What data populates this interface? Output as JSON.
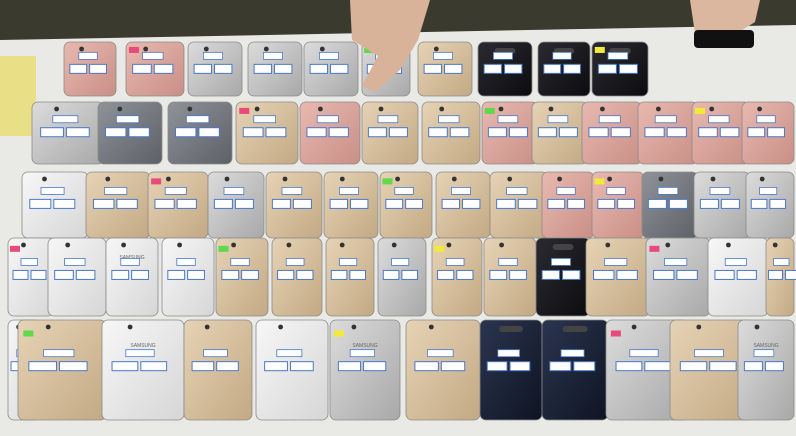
{
  "scene": {
    "description_type": "photo",
    "brand_text": "SAMSUNG",
    "colors": {
      "table": "#e9e9e6",
      "background_dark": "#2a2a26",
      "sticker_white": "#ffffff",
      "sticker_border": "#4a78c8",
      "sticker_yellow": "#f2ea3a",
      "sticker_pink": "#e84a7a",
      "sticker_green": "#5fd84a"
    },
    "phone_colors": [
      "rose-gold",
      "silver",
      "gold",
      "space-gray",
      "black",
      "white"
    ]
  }
}
